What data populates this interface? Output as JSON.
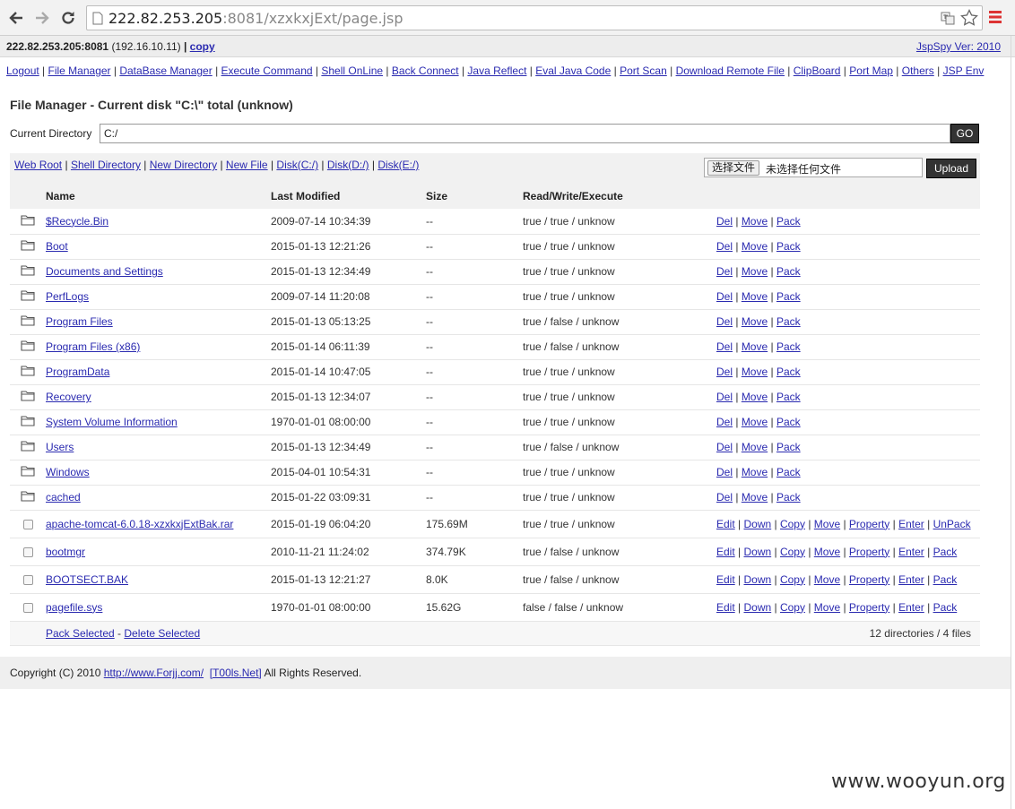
{
  "browser": {
    "url_host": "222.82.253.205",
    "url_rest": ":8081/xzxkxjExt/page.jsp"
  },
  "header": {
    "server": "222.82.253.205:8081",
    "local_ip": "(192.16.10.11)",
    "separator": "|",
    "copy_label": "copy",
    "version": "JspSpy Ver: 2010"
  },
  "menu": [
    "Logout",
    "File Manager",
    "DataBase Manager",
    "Execute Command",
    "Shell OnLine",
    "Back Connect",
    "Java Reflect",
    "Eval Java Code",
    "Port Scan",
    "Download Remote File",
    "ClipBoard",
    "Port Map",
    "Others",
    "JSP Env"
  ],
  "title": "File Manager - Current disk \"C:\\\" total (unknow)",
  "current_directory": {
    "label": "Current Directory",
    "value": "C:/",
    "go_label": "GO"
  },
  "toolbar": {
    "links": [
      "Web Root",
      "Shell Directory",
      "New Directory",
      "New File",
      "Disk(C:/)",
      "Disk(D:/)",
      "Disk(E:/)"
    ],
    "choose_file": "选择文件",
    "no_file": "未选择任何文件",
    "upload_label": "Upload"
  },
  "table": {
    "headers": [
      "Name",
      "Last Modified",
      "Size",
      "Read/Write/Execute"
    ],
    "dir_actions": [
      "Del",
      "Move",
      "Pack"
    ],
    "directories": [
      {
        "name": "$Recycle.Bin",
        "modified": "2009-07-14 10:34:39",
        "size": "--",
        "rwx": "true / true / unknow"
      },
      {
        "name": "Boot",
        "modified": "2015-01-13 12:21:26",
        "size": "--",
        "rwx": "true / true / unknow"
      },
      {
        "name": "Documents and Settings",
        "modified": "2015-01-13 12:34:49",
        "size": "--",
        "rwx": "true / true / unknow"
      },
      {
        "name": "PerfLogs",
        "modified": "2009-07-14 11:20:08",
        "size": "--",
        "rwx": "true / true / unknow"
      },
      {
        "name": "Program Files",
        "modified": "2015-01-13 05:13:25",
        "size": "--",
        "rwx": "true / false / unknow"
      },
      {
        "name": "Program Files (x86)",
        "modified": "2015-01-14 06:11:39",
        "size": "--",
        "rwx": "true / false / unknow"
      },
      {
        "name": "ProgramData",
        "modified": "2015-01-14 10:47:05",
        "size": "--",
        "rwx": "true / true / unknow"
      },
      {
        "name": "Recovery",
        "modified": "2015-01-13 12:34:07",
        "size": "--",
        "rwx": "true / true / unknow"
      },
      {
        "name": "System Volume Information",
        "modified": "1970-01-01 08:00:00",
        "size": "--",
        "rwx": "true / true / unknow"
      },
      {
        "name": "Users",
        "modified": "2015-01-13 12:34:49",
        "size": "--",
        "rwx": "true / false / unknow"
      },
      {
        "name": "Windows",
        "modified": "2015-04-01 10:54:31",
        "size": "--",
        "rwx": "true / true / unknow"
      },
      {
        "name": "cached",
        "modified": "2015-01-22 03:09:31",
        "size": "--",
        "rwx": "true / true / unknow"
      }
    ],
    "files": [
      {
        "name": "apache-tomcat-6.0.18-xzxkxjExtBak.rar",
        "modified": "2015-01-19 06:04:20",
        "size": "175.69M",
        "rwx": "true / true / unknow",
        "actions": [
          "Edit",
          "Down",
          "Copy",
          "Move",
          "Property",
          "Enter",
          "UnPack"
        ]
      },
      {
        "name": "bootmgr",
        "modified": "2010-11-21 11:24:02",
        "size": "374.79K",
        "rwx": "true / false / unknow",
        "actions": [
          "Edit",
          "Down",
          "Copy",
          "Move",
          "Property",
          "Enter",
          "Pack"
        ]
      },
      {
        "name": "BOOTSECT.BAK",
        "modified": "2015-01-13 12:21:27",
        "size": "8.0K",
        "rwx": "true / false / unknow",
        "actions": [
          "Edit",
          "Down",
          "Copy",
          "Move",
          "Property",
          "Enter",
          "Pack"
        ]
      },
      {
        "name": "pagefile.sys",
        "modified": "1970-01-01 08:00:00",
        "size": "15.62G",
        "rwx": "false / false / unknow",
        "actions": [
          "Edit",
          "Down",
          "Copy",
          "Move",
          "Property",
          "Enter",
          "Pack"
        ]
      }
    ],
    "footer": {
      "pack_selected": "Pack Selected",
      "dash": " - ",
      "delete_selected": "Delete Selected",
      "summary": "12 directories / 4 files"
    }
  },
  "copyright": {
    "prefix": "Copyright (C) 2010 ",
    "link1": "http://www.Forjj.com/",
    "link2": "[T00ls.Net]",
    "suffix": " All Rights Reserved."
  },
  "watermark": "www.wooyun.org"
}
